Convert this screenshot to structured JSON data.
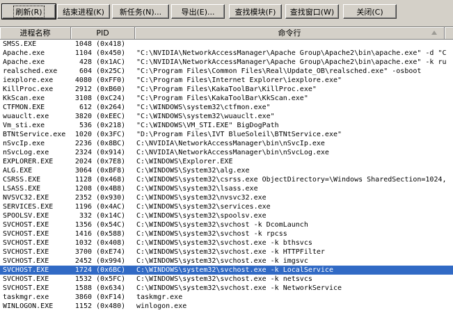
{
  "toolbar": {
    "refresh": "刷新(R)",
    "end_process": "结束进程(K)",
    "new_task": "新任务(N)...",
    "export": "导出(E)...",
    "find_module": "查找模块(F)",
    "find_window": "查找窗口(W)",
    "close": "关闭(C)"
  },
  "columns": {
    "name": "进程名称",
    "pid": "PID",
    "cmd": "命令行"
  },
  "rows": [
    {
      "name": "SMSS.EXE",
      "pid": "1048",
      "hex": "(0x418)",
      "cmd": ""
    },
    {
      "name": "Apache.exe",
      "pid": "1104",
      "hex": "(0x450)",
      "cmd": "\"C:\\NVIDIA\\NetworkAccessManager\\Apache Group\\Apache2\\bin\\apache.exe\" -d \"C"
    },
    {
      "name": "Apache.exe",
      "pid": "428",
      "hex": "(0x1AC)",
      "cmd": "\"C:\\NVIDIA\\NetworkAccessManager\\Apache Group\\Apache2\\bin\\apache.exe\" -k ru"
    },
    {
      "name": "realsched.exe",
      "pid": "604",
      "hex": "(0x25C)",
      "cmd": "\"C:\\Program Files\\Common Files\\Real\\Update_OB\\realsched.exe\"  -osboot"
    },
    {
      "name": "iexplore.exe",
      "pid": "4080",
      "hex": "(0xFF0)",
      "cmd": "\"C:\\Program Files\\Internet Explorer\\iexplore.exe\""
    },
    {
      "name": "KillProc.exe",
      "pid": "2912",
      "hex": "(0xB60)",
      "cmd": "\"C:\\Program Files\\KakaToolBar\\KillProc.exe\""
    },
    {
      "name": "KkScan.exe",
      "pid": "3108",
      "hex": "(0xC24)",
      "cmd": "\"C:\\Program Files\\KakaToolBar\\KkScan.exe\""
    },
    {
      "name": "CTFMON.EXE",
      "pid": "612",
      "hex": "(0x264)",
      "cmd": "\"C:\\WINDOWS\\system32\\ctfmon.exe\""
    },
    {
      "name": "wuauclt.exe",
      "pid": "3820",
      "hex": "(0xEEC)",
      "cmd": "\"C:\\WINDOWS\\system32\\wuauclt.exe\""
    },
    {
      "name": "Vm_sti.exe",
      "pid": "536",
      "hex": "(0x218)",
      "cmd": "\"C:\\WINDOWS\\VM_STI.EXE\" BigDogPath"
    },
    {
      "name": "BTNtService.exe",
      "pid": "1020",
      "hex": "(0x3FC)",
      "cmd": "\"D:\\Program Files\\IVT BlueSoleil\\BTNtService.exe\""
    },
    {
      "name": "nSvcIp.exe",
      "pid": "2236",
      "hex": "(0x8BC)",
      "cmd": "C:\\NVIDIA\\NetworkAccessManager\\bin\\nSvcIp.exe"
    },
    {
      "name": "nSvcLog.exe",
      "pid": "2324",
      "hex": "(0x914)",
      "cmd": "C:\\NVIDIA\\NetworkAccessManager\\bin\\nSvcLog.exe"
    },
    {
      "name": "EXPLORER.EXE",
      "pid": "2024",
      "hex": "(0x7E8)",
      "cmd": "C:\\WINDOWS\\Explorer.EXE"
    },
    {
      "name": "ALG.EXE",
      "pid": "3064",
      "hex": "(0xBF8)",
      "cmd": "C:\\WINDOWS\\System32\\alg.exe"
    },
    {
      "name": "CSRSS.EXE",
      "pid": "1128",
      "hex": "(0x468)",
      "cmd": "C:\\WINDOWS\\system32\\csrss.exe ObjectDirectory=\\Windows SharedSection=1024,"
    },
    {
      "name": "LSASS.EXE",
      "pid": "1208",
      "hex": "(0x4B8)",
      "cmd": "C:\\WINDOWS\\system32\\lsass.exe"
    },
    {
      "name": "NVSVC32.EXE",
      "pid": "2352",
      "hex": "(0x930)",
      "cmd": "C:\\WINDOWS\\system32\\nvsvc32.exe"
    },
    {
      "name": "SERVICES.EXE",
      "pid": "1196",
      "hex": "(0x4AC)",
      "cmd": "C:\\WINDOWS\\system32\\services.exe"
    },
    {
      "name": "SPOOLSV.EXE",
      "pid": "332",
      "hex": "(0x14C)",
      "cmd": "C:\\WINDOWS\\system32\\spoolsv.exe"
    },
    {
      "name": "SVCHOST.EXE",
      "pid": "1356",
      "hex": "(0x54C)",
      "cmd": "C:\\WINDOWS\\system32\\svchost -k DcomLaunch"
    },
    {
      "name": "SVCHOST.EXE",
      "pid": "1416",
      "hex": "(0x588)",
      "cmd": "C:\\WINDOWS\\system32\\svchost -k rpcss"
    },
    {
      "name": "SVCHOST.EXE",
      "pid": "1032",
      "hex": "(0x408)",
      "cmd": "C:\\WINDOWS\\system32\\svchost.exe -k bthsvcs"
    },
    {
      "name": "SVCHOST.EXE",
      "pid": "3700",
      "hex": "(0xE74)",
      "cmd": "C:\\WINDOWS\\system32\\svchost.exe -k HTTPFilter"
    },
    {
      "name": "SVCHOST.EXE",
      "pid": "2452",
      "hex": "(0x994)",
      "cmd": "C:\\WINDOWS\\system32\\svchost.exe -k imgsvc"
    },
    {
      "name": "SVCHOST.EXE",
      "pid": "1724",
      "hex": "(0x6BC)",
      "cmd": "C:\\WINDOWS\\system32\\svchost.exe -k LocalService",
      "selected": true
    },
    {
      "name": "SVCHOST.EXE",
      "pid": "1532",
      "hex": "(0x5FC)",
      "cmd": "C:\\WINDOWS\\system32\\svchost.exe -k netsvcs"
    },
    {
      "name": "SVCHOST.EXE",
      "pid": "1588",
      "hex": "(0x634)",
      "cmd": "C:\\WINDOWS\\system32\\svchost.exe -k NetworkService"
    },
    {
      "name": "taskmgr.exe",
      "pid": "3860",
      "hex": "(0xF14)",
      "cmd": "taskmgr.exe"
    },
    {
      "name": "WINLOGON.EXE",
      "pid": "1152",
      "hex": "(0x480)",
      "cmd": "winlogon.exe"
    }
  ],
  "colors": {
    "selection": "#316ac5",
    "chrome": "#d4d0c8"
  }
}
